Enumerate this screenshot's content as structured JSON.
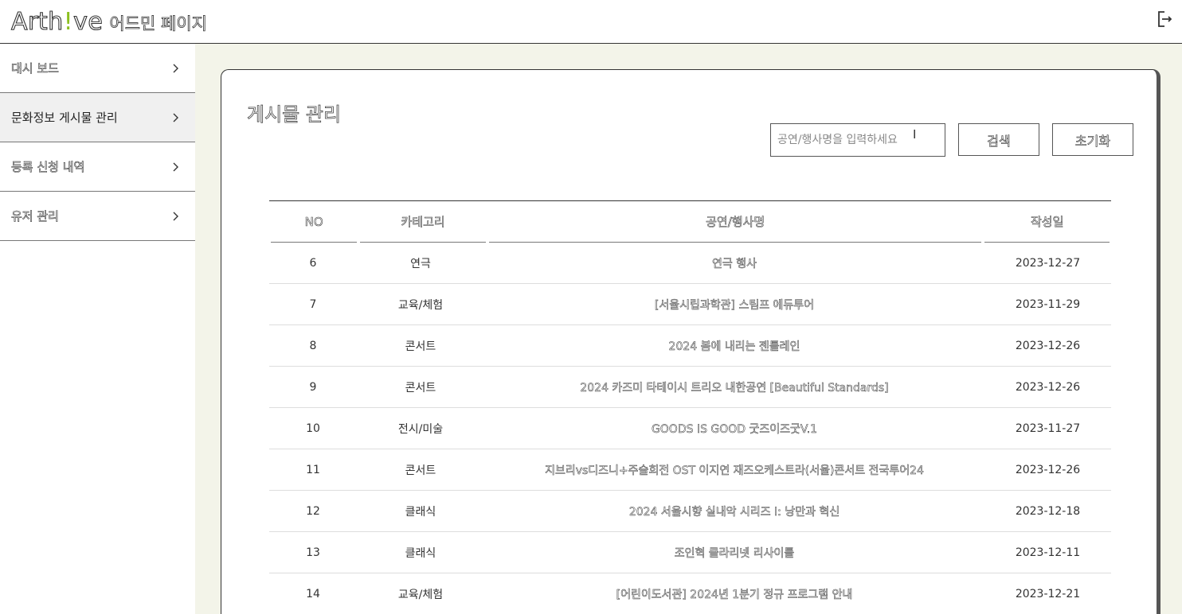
{
  "header": {
    "logo_prefix": "Arth",
    "logo_bang": "!",
    "logo_suffix": "ve",
    "subtitle": "어드민 페이지"
  },
  "sidebar": {
    "items": [
      {
        "label": "대시 보드"
      },
      {
        "label": "문화정보 게시물 관리"
      },
      {
        "label": "등록 신청 내역"
      },
      {
        "label": "유저 관리"
      }
    ]
  },
  "main": {
    "title": "게시물 관리",
    "search": {
      "placeholder": "공연/행사명을 입력하세요"
    },
    "search_button": "검색",
    "reset_button": "초기화",
    "table": {
      "headers": [
        "NO",
        "카테고리",
        "공연/행사명",
        "작성일"
      ],
      "rows": [
        {
          "no": "6",
          "category": "연극",
          "title": "연극 행사",
          "date": "2023-12-27"
        },
        {
          "no": "7",
          "category": "교육/체험",
          "title": "[서울시립과학관] 스팀프 에듀투어",
          "date": "2023-11-29"
        },
        {
          "no": "8",
          "category": "콘서트",
          "title": "2024 봄에 내리는 젠틀레인",
          "date": "2023-12-26"
        },
        {
          "no": "9",
          "category": "콘서트",
          "title": "2024 카즈미 타테이시 트리오 내한공연 [Beautiful Standards]",
          "date": "2023-12-26"
        },
        {
          "no": "10",
          "category": "전시/미술",
          "title": "GOODS IS GOOD 굿즈이즈굿V.1",
          "date": "2023-11-27"
        },
        {
          "no": "11",
          "category": "콘서트",
          "title": "지브리vs디즈니+주술회전 OST 이지연 재즈오케스트라(서울)콘서트 전국투어24",
          "date": "2023-12-26"
        },
        {
          "no": "12",
          "category": "클래식",
          "title": "2024 서울시향 실내악 시리즈 I: 낭만과 혁신",
          "date": "2023-12-18"
        },
        {
          "no": "13",
          "category": "클래식",
          "title": "조인혁 클라리넷 리사이틀",
          "date": "2023-12-11"
        },
        {
          "no": "14",
          "category": "교육/체험",
          "title": "[어린이도서관] 2024년 1분기 정규 프로그램 안내",
          "date": "2023-12-21"
        }
      ]
    }
  },
  "icons": {
    "logout": "logout-icon",
    "chevron": "chevron-right-icon"
  },
  "colors": {
    "main_bg": "#f3f4e9",
    "active_item_bg": "#f0f0f0",
    "logo_accent": "#8bbf1e"
  }
}
